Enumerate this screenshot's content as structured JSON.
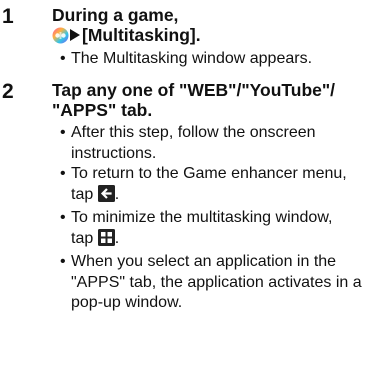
{
  "steps": [
    {
      "number": "1",
      "title_line1": "During a game,",
      "title_line2_suffix": "[Multitasking].",
      "bullets": [
        "The Multitasking window appears."
      ]
    },
    {
      "number": "2",
      "title_line1": "Tap any one of \"WEB\"/\"YouTube\"/",
      "title_line2": "\"APPS\" tab.",
      "bullets": [
        "After this step, follow the onscreen",
        "instructions.",
        "To return to the Game enhancer menu,",
        "tap",
        "To minimize the multitasking window,",
        "tap",
        "When you select an application in the",
        "\"APPS\" tab, the application activates in a",
        "pop-up window."
      ]
    }
  ],
  "punctuation": {
    "period": "."
  },
  "icons": {
    "game_enhancer": "game-enhancer-icon",
    "arrow": "play-arrow-icon",
    "back": "back-arrow-icon",
    "minimize": "minimize-grid-icon"
  },
  "colors": {
    "text": "#111111",
    "icon_dark": "#222222",
    "icon_white": "#ffffff"
  }
}
